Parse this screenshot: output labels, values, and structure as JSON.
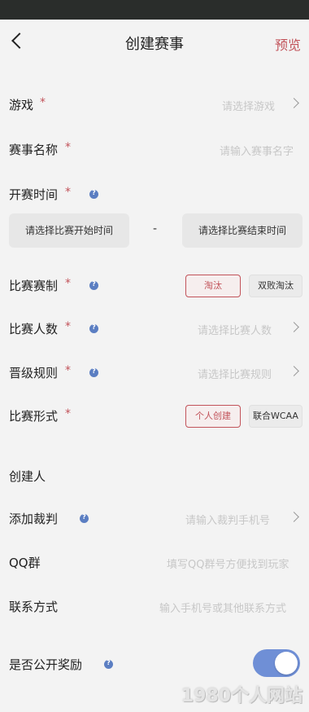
{
  "header": {
    "title": "创建赛事",
    "preview_label": "预览"
  },
  "form": {
    "game": {
      "label": "游戏",
      "required_mark": "*",
      "placeholder": "请选择游戏"
    },
    "event_name": {
      "label": "赛事名称",
      "required_mark": "*",
      "placeholder": "请输入赛事名字"
    },
    "start_time": {
      "label": "开赛时间",
      "required_mark": "*",
      "start_button": "请选择比赛开始时间",
      "separator": "-",
      "end_button": "请选择比赛结束时间"
    },
    "format": {
      "label": "比赛赛制",
      "required_mark": "*",
      "options": [
        "淘汰",
        "双败淘汰"
      ],
      "selected": "淘汰"
    },
    "player_count": {
      "label": "比赛人数",
      "required_mark": "*",
      "placeholder": "请选择比赛人数"
    },
    "advance_rule": {
      "label": "晋级规则",
      "required_mark": "*",
      "placeholder": "请选择比赛规则"
    },
    "mode": {
      "label": "比赛形式",
      "required_mark": "*",
      "options": [
        "个人创建",
        "联合WCAA"
      ],
      "selected": "个人创建"
    },
    "creator": {
      "label": "创建人"
    },
    "referee": {
      "label": "添加裁判",
      "placeholder": "请输入裁判手机号"
    },
    "qq_group": {
      "label": "QQ群",
      "placeholder": "填写QQ群号方便找到玩家"
    },
    "contact": {
      "label": "联系方式",
      "placeholder": "输入手机号或其他联系方式"
    },
    "public_reward": {
      "label": "是否公开奖励",
      "enabled": true
    }
  },
  "watermark": "1980个人网站",
  "colors": {
    "accent": "#c2535a",
    "toggle_on": "#6f8fd6",
    "info_icon": "#5b7ec2",
    "status_bar": "#2a2d2b"
  }
}
